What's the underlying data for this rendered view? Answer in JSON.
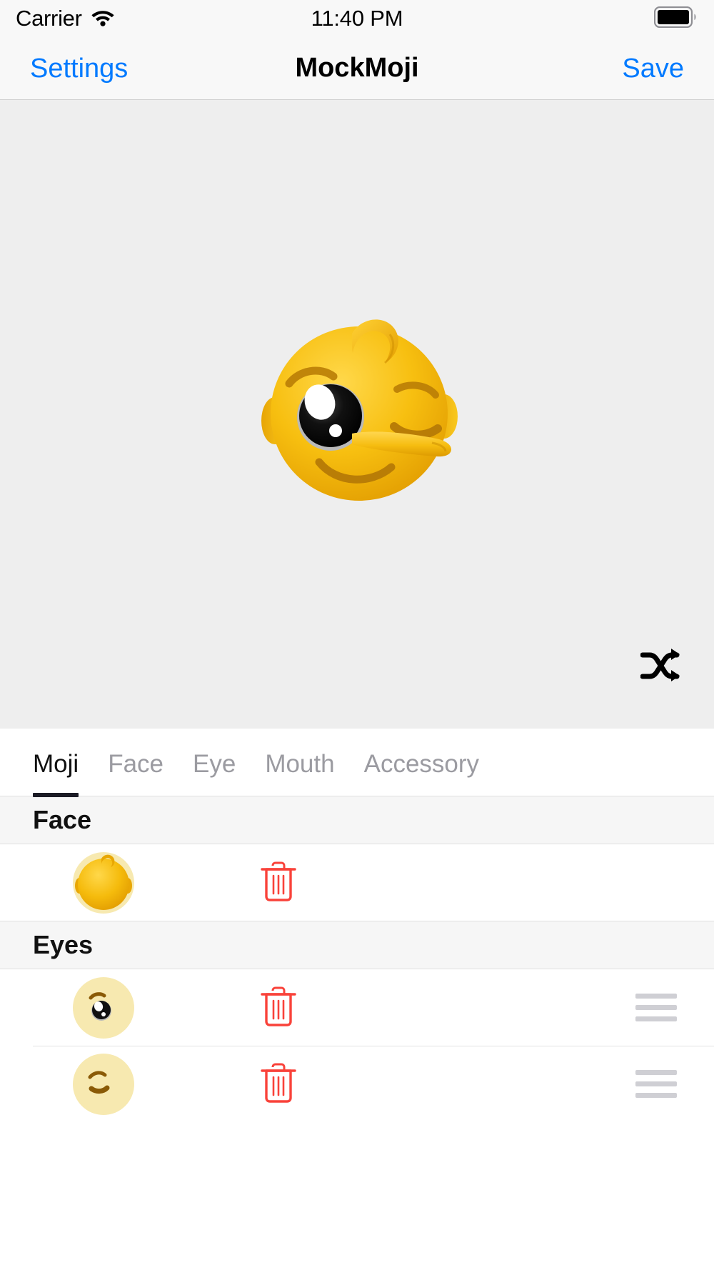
{
  "statusbar": {
    "carrier": "Carrier",
    "wifi_icon": "wifi-icon",
    "time": "11:40 PM",
    "battery_icon": "battery-full-icon"
  },
  "navbar": {
    "back_label": "Settings",
    "title": "MockMoji",
    "save_label": "Save"
  },
  "preview": {
    "avatar_name": "moji-avatar-preview",
    "shuffle_icon": "shuffle-icon",
    "background_color": "#eeeeee",
    "face_color": "#f5b800",
    "description": "Yellow emoji face with hair curl, one open eye, one winking eye, long nose and smile"
  },
  "tabs": {
    "active_index": 0,
    "items": [
      {
        "label": "Moji"
      },
      {
        "label": "Face"
      },
      {
        "label": "Eye"
      },
      {
        "label": "Mouth"
      },
      {
        "label": "Accessory"
      }
    ]
  },
  "colors": {
    "accent": "#007aff",
    "delete": "#f9423a",
    "handle": "#cfcfd4",
    "section_bg": "#f6f6f6"
  },
  "sections": [
    {
      "title": "Face",
      "rows": [
        {
          "thumb_name": "face-thumbnail",
          "thumb_kind": "face",
          "delete_icon": "trash-icon",
          "has_handle": false
        }
      ]
    },
    {
      "title": "Eyes",
      "rows": [
        {
          "thumb_name": "eye-open-thumbnail",
          "thumb_kind": "eye-open",
          "delete_icon": "trash-icon",
          "has_handle": true,
          "handle_icon": "reorder-handle-icon"
        },
        {
          "thumb_name": "eye-wink-thumbnail",
          "thumb_kind": "eye-wink",
          "delete_icon": "trash-icon",
          "has_handle": true,
          "handle_icon": "reorder-handle-icon"
        }
      ]
    }
  ]
}
